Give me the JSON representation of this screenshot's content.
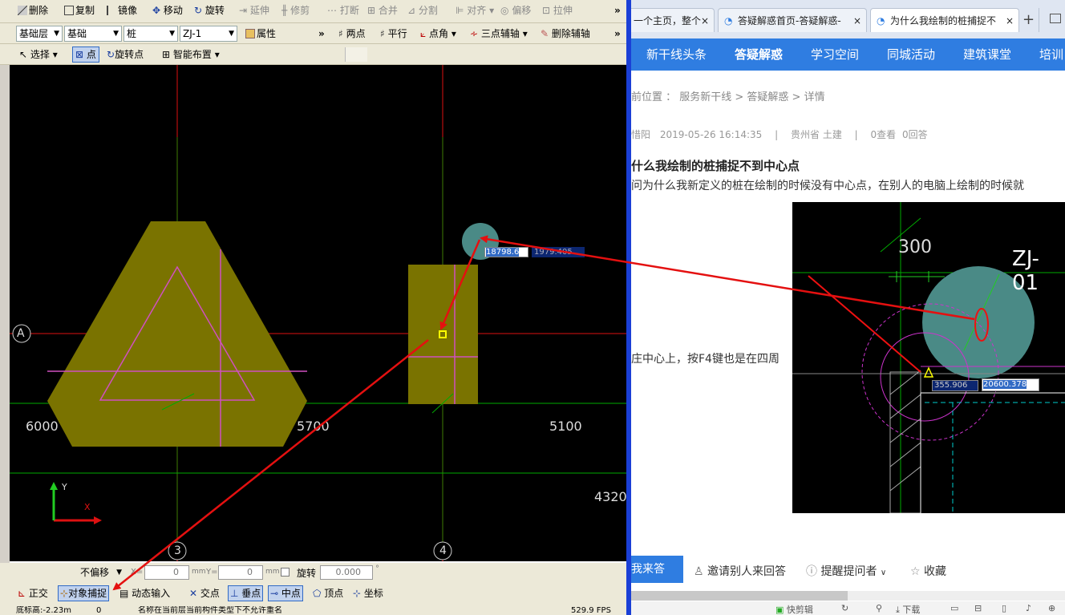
{
  "cad_app": {
    "toolbar1": {
      "delete": "删除",
      "copy": "复制",
      "mirror": "镜像",
      "move": "移动",
      "rotate": "旋转",
      "extend": "延伸",
      "trim": "修剪",
      "break": "打断",
      "merge": "合并",
      "split": "分割",
      "align": "对齐",
      "offset": "偏移",
      "stretch": "拉伸"
    },
    "toolbar2": {
      "layer_group": "基础层",
      "layer": "基础",
      "component": "桩",
      "component_name": "ZJ-1",
      "properties": "属性",
      "two_point": "两点",
      "parallel": "平行",
      "point_angle": "点角",
      "three_point_aux": "三点辅轴",
      "delete_aux": "删除辅轴"
    },
    "toolbar3": {
      "select": "选择",
      "point": "点",
      "rotate_point": "旋转点",
      "smart_layout": "智能布置"
    },
    "canvas": {
      "axis_a": "A",
      "axis_3": "3",
      "axis_4": "4",
      "dim_6000": "6000",
      "dim_5700": "5700",
      "dim_5100": "5100",
      "dim_4320": "4320",
      "coord_input_x": "18798.6",
      "coord_input_y": "1979.405",
      "ucs_y": "Y",
      "ucs_x": "X"
    },
    "offset_bar": {
      "mode": "不偏移",
      "x_label": "X=",
      "x_value": "0",
      "y_label": "Y=",
      "y_value": "0",
      "unit_mm": "mm",
      "rotate": "旋转",
      "rotate_value": "0.000",
      "degree": "°"
    },
    "snap_bar": {
      "ortho": "正交",
      "object_snap": "对象捕捉",
      "dynamic_input": "动态输入",
      "intersection": "交点",
      "perpendicular": "垂点",
      "midpoint": "中点",
      "vertex": "顶点",
      "coordinate": "坐标"
    },
    "status": {
      "elevation": "底标高:-2.23m",
      "zero": "0",
      "message": "名称在当前层当前构件类型下不允许重名",
      "fps": "529.9 FPS"
    }
  },
  "browser": {
    "tabs": [
      {
        "label": "一个主页，整个"
      },
      {
        "label": "答疑解惑首页-答疑解惑-"
      },
      {
        "label": "为什么我绘制的桩捕捉不"
      }
    ],
    "nav": [
      "新干线头条",
      "答疑解惑",
      "学习空间",
      "同城活动",
      "建筑课堂",
      "培训"
    ],
    "breadcrumb": "前位置 ： 服务新干线 > 答疑解惑 > 详情",
    "breadcrumb_current": "详情",
    "meta": {
      "user": "惜阳",
      "date": "2019-05-26 16:14:35",
      "region": "贵州省 土建",
      "views": "0查看",
      "answers": "0回答"
    },
    "question_title": "什么我绘制的桩捕捉不到中心点",
    "question_desc": "问为什么我新定义的桩在绘制的时候没有中心点，在别人的电脑上绘制的时候就",
    "question_body": "庄中心上，按F4键也是在四周",
    "embedded_image": {
      "dim_300": "300",
      "label_zj": "ZJ-01",
      "coord_x": "355.906",
      "coord_y": "20600.378"
    },
    "actions": {
      "answer": "我来答",
      "invite": "邀请别人来回答",
      "remind": "提醒提问者",
      "favorite": "收藏"
    },
    "bottom_bar": {
      "clip": "快剪辑",
      "download": "下载"
    }
  }
}
